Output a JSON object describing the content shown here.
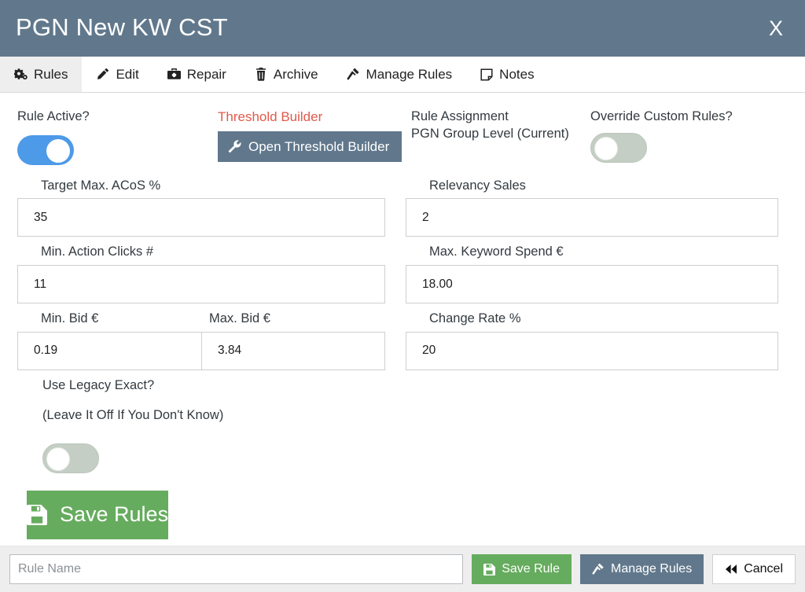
{
  "header": {
    "title": "PGN New KW CST",
    "close_label": "X",
    "bg_color": "#61788c"
  },
  "tabs": [
    {
      "label": "Rules",
      "icon": "gears-icon",
      "active": true
    },
    {
      "label": "Edit",
      "icon": "pencil-icon",
      "active": false
    },
    {
      "label": "Repair",
      "icon": "toolbox-icon",
      "active": false
    },
    {
      "label": "Archive",
      "icon": "trash-icon",
      "active": false
    },
    {
      "label": "Manage Rules",
      "icon": "gavel-icon",
      "active": false
    },
    {
      "label": "Notes",
      "icon": "note-icon",
      "active": false
    }
  ],
  "form": {
    "rule_active": {
      "label": "Rule Active?",
      "state": "on"
    },
    "threshold": {
      "title": "Threshold Builder",
      "title_color": "#e2594a",
      "button_label": "Open Threshold Builder",
      "button_icon": "wrench-icon"
    },
    "rule_assignment": {
      "label": "Rule Assignment",
      "value": "PGN Group Level (Current)"
    },
    "override_custom_rules": {
      "label": "Override Custom Rules?",
      "state": "off"
    },
    "fields": {
      "target_max_acos": {
        "label": "Target Max. ACoS %",
        "value": "35"
      },
      "relevancy_sales": {
        "label": "Relevancy Sales",
        "value": "2"
      },
      "min_action_clicks": {
        "label": "Min. Action Clicks #",
        "value": "11"
      },
      "max_keyword_spend": {
        "label": "Max. Keyword Spend €",
        "value": "18.00"
      },
      "min_bid": {
        "label": "Min. Bid €",
        "value": "0.19"
      },
      "max_bid": {
        "label": "Max. Bid €",
        "value": "3.84"
      },
      "change_rate": {
        "label": "Change Rate %",
        "value": "20"
      }
    },
    "use_legacy_exact": {
      "label": "Use Legacy Exact?",
      "hint": "(Leave It Off If You Don't Know)",
      "state": "off"
    },
    "save_rules_button": {
      "label": "Save Rules",
      "icon": "floppy-icon",
      "color": "#66ac5e"
    }
  },
  "footer": {
    "rule_name_placeholder": "Rule Name",
    "rule_name_value": "",
    "save_rule": {
      "label": "Save Rule",
      "icon": "floppy-icon",
      "color": "#66ac5e"
    },
    "manage_rules": {
      "label": "Manage Rules",
      "icon": "gavel-icon",
      "color": "#61788c"
    },
    "cancel": {
      "label": "Cancel",
      "icon": "backward-icon"
    }
  }
}
